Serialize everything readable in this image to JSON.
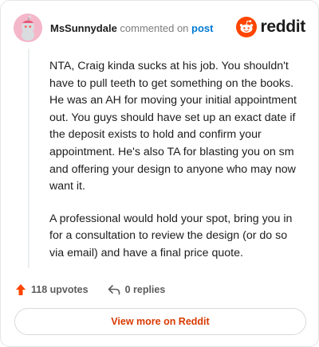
{
  "header": {
    "username": "MsSunnydale",
    "action_text": "commented on",
    "post_link": "post",
    "brand_name": "reddit"
  },
  "comment": {
    "paragraphs": [
      "NTA, Craig kinda sucks at his job. You shouldn't have to pull teeth to get something on the books. He was an AH for moving your initial appointment out. You guys should have set up an exact date if the deposit exists to hold and confirm your appointment. He's also TA for blasting you on sm and offering your design to anyone who may now want it.",
      "A professional would hold your spot, bring you in for a consultation to review the design (or do so via email) and have a final price quote."
    ]
  },
  "footer": {
    "upvotes_label": "118 upvotes",
    "replies_label": "0 replies",
    "upvote_icon": "upvote-arrow-icon",
    "reply_icon": "reply-arrow-icon"
  },
  "actions": {
    "view_more_label": "View more on Reddit"
  },
  "colors": {
    "brand_orange": "#ff4500",
    "link_blue": "#0079d3",
    "button_text": "#d93a00",
    "avatar_bg": "#f4b7c9"
  }
}
